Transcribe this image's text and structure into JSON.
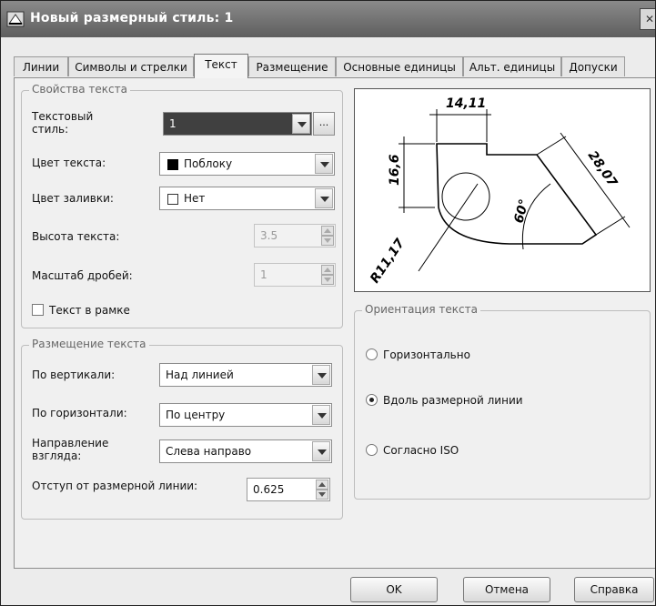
{
  "window": {
    "title": "Новый размерный стиль: 1",
    "close_glyph": "✕"
  },
  "tabs": [
    {
      "label": "Линии",
      "active": false
    },
    {
      "label": "Символы и стрелки",
      "active": false
    },
    {
      "label": "Текст",
      "active": true
    },
    {
      "label": "Размещение",
      "active": false
    },
    {
      "label": "Основные единицы",
      "active": false
    },
    {
      "label": "Альт. единицы",
      "active": false
    },
    {
      "label": "Допуски",
      "active": false
    }
  ],
  "text_props": {
    "legend": "Свойства текста",
    "style_label": "Текстовый стиль:",
    "style_value": "1",
    "style_browse_label": "...",
    "color_label": "Цвет текста:",
    "color_value": "Поблоку",
    "color_swatch": "#000000",
    "fill_label": "Цвет заливки:",
    "fill_value": "Нет",
    "height_label": "Высота текста:",
    "height_value": "3.5",
    "scale_label": "Масштаб дробей:",
    "scale_value": "1",
    "frame_label": "Текст в рамке",
    "frame_checked": false
  },
  "placement": {
    "legend": "Размещение текста",
    "vertical_label": "По вертикали:",
    "vertical_value": "Над линией",
    "horizontal_label": "По горизонтали:",
    "horizontal_value": "По центру",
    "view_label": "Направление взгляда:",
    "view_value": "Слева направо",
    "offset_label": "Отступ от размерной линии:",
    "offset_value": "0.625"
  },
  "orientation": {
    "legend": "Ориентация текста",
    "options": [
      {
        "label": "Горизонтально",
        "checked": false
      },
      {
        "label": "Вдоль размерной линии",
        "checked": true
      },
      {
        "label": "Согласно ISO",
        "checked": false
      }
    ]
  },
  "preview": {
    "dim_top": "14,11",
    "dim_left": "16,6",
    "dim_right": "28,07",
    "dim_angle": "60°",
    "dim_radius": "R11,17"
  },
  "buttons": {
    "ok": "OK",
    "cancel": "Отмена",
    "help": "Справка"
  },
  "icons": {
    "app": "autocad-dimstyle-icon",
    "close": "close-icon",
    "dropdown": "chevron-down-icon"
  }
}
